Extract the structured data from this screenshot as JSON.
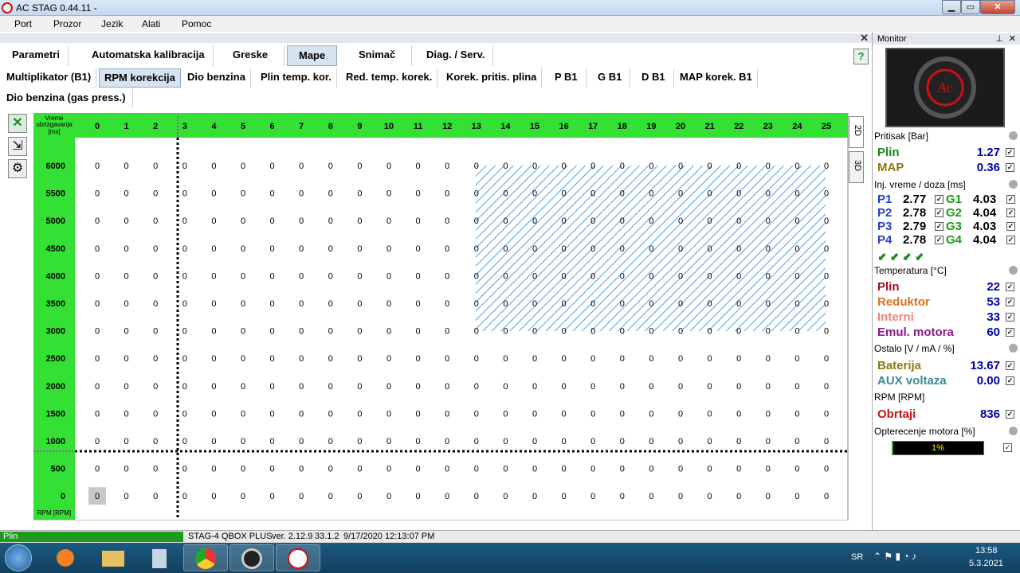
{
  "window": {
    "title": "AC STAG 0.44.11 -"
  },
  "menu": [
    "Port",
    "Prozor",
    "Jezik",
    "Alati",
    "Pomoc"
  ],
  "main_tabs": [
    "Parametri",
    "Automatska kalibracija",
    "Greske",
    "Mape",
    "Snimač",
    "Diag. / Serv."
  ],
  "active_main_tab": "Mape",
  "sub_tabs": [
    "Multiplikator (B1)",
    "RPM korekcija",
    "Dio benzina",
    "Plin temp. kor.",
    "Red. temp. korek.",
    "Korek. pritis. plina",
    "P B1",
    "G B1",
    "D B1",
    "MAP korek. B1"
  ],
  "active_sub_tab": "RPM korekcija",
  "sub_tab_row2": "Dio benzina (gas press.)",
  "grid": {
    "corner_label": "Vreme ubrizgavanja [ms]",
    "rpm_axis_label": "RPM [RPM]",
    "columns": [
      "0",
      "1",
      "2",
      "3",
      "4",
      "5",
      "6",
      "7",
      "8",
      "9",
      "10",
      "11",
      "12",
      "13",
      "14",
      "15",
      "16",
      "17",
      "18",
      "19",
      "20",
      "21",
      "22",
      "23",
      "24",
      "25"
    ],
    "rows": [
      "6000",
      "5500",
      "5000",
      "4500",
      "4000",
      "3500",
      "3000",
      "2500",
      "2000",
      "1500",
      "1000",
      "500",
      "0"
    ],
    "cell_value": "0",
    "selected_cell_value": "0",
    "view_tabs": [
      "2D",
      "3D"
    ],
    "colors": {
      "header": "#33e033",
      "hatch": "#4aa0e8",
      "marker": "#cc33cc"
    }
  },
  "monitor": {
    "title": "Monitor",
    "pressure": {
      "title": "Pritisak [Bar]",
      "rows": [
        {
          "label": "Plin",
          "value": "1.27",
          "color": "#1a8a1a"
        },
        {
          "label": "MAP",
          "value": "0.36",
          "color": "#8a7a10"
        }
      ]
    },
    "injection": {
      "title": "Inj. vreme / doza [ms]",
      "rows": [
        {
          "p": "P1",
          "pv": "2.77",
          "g": "G1",
          "gv": "4.03"
        },
        {
          "p": "P2",
          "pv": "2.78",
          "g": "G2",
          "gv": "4.04"
        },
        {
          "p": "P3",
          "pv": "2.79",
          "g": "G3",
          "gv": "4.03"
        },
        {
          "p": "P4",
          "pv": "2.78",
          "g": "G4",
          "gv": "4.04"
        }
      ]
    },
    "temperature": {
      "title": "Temperatura [°C]",
      "rows": [
        {
          "label": "Plin",
          "value": "22",
          "color": "#a01020"
        },
        {
          "label": "Reduktor",
          "value": "53",
          "color": "#e07020"
        },
        {
          "label": "Interni",
          "value": "33",
          "color": "#f08080"
        },
        {
          "label": "Emul. motora",
          "value": "60",
          "color": "#8a1a8a"
        }
      ]
    },
    "other": {
      "title": "Ostalo [V / mA / %]",
      "rows": [
        {
          "label": "Baterija",
          "value": "13.67",
          "color": "#8a7a10"
        },
        {
          "label": "AUX voltaza",
          "value": "0.00",
          "color": "#3a8a9a"
        }
      ]
    },
    "rpm": {
      "title": "RPM [RPM]",
      "label": "Obrtaji",
      "value": "836"
    },
    "load": {
      "title": "Opterecenje motora [%]",
      "value": "1%",
      "fraction": 0.01
    }
  },
  "status": {
    "left": "Plin",
    "device": "STAG-4 QBOX PLUS",
    "version": "ver. 2.12.9",
    "fw": "33.1.2",
    "datetime": "9/17/2020 12:13:07 PM"
  },
  "taskbar": {
    "lang": "SR",
    "time": "13:58",
    "date": "5.3.2021"
  }
}
